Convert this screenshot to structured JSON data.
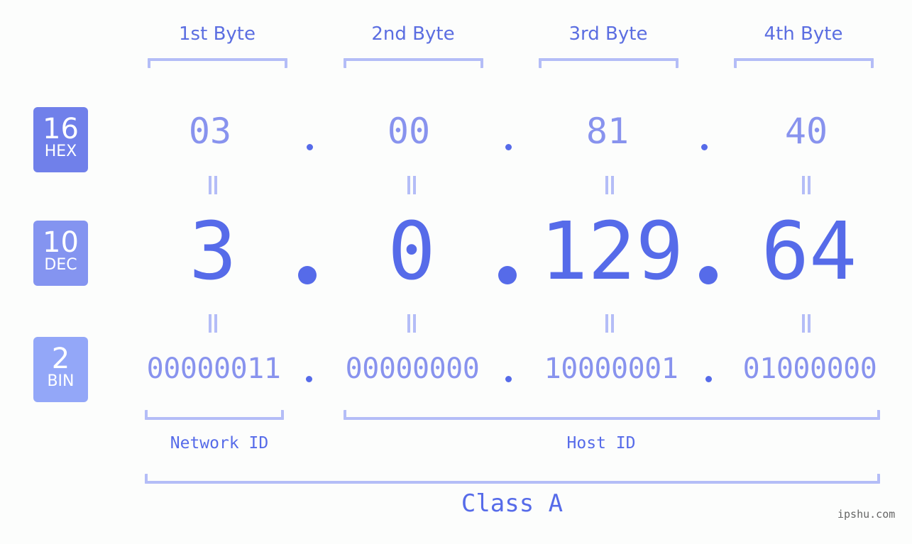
{
  "byte_headers": [
    "1st Byte",
    "2nd Byte",
    "3rd Byte",
    "4th Byte"
  ],
  "badges": {
    "hex": {
      "number": "16",
      "label": "HEX",
      "color": "#7080ea"
    },
    "dec": {
      "number": "10",
      "label": "DEC",
      "color": "#8494f0"
    },
    "bin": {
      "number": "2",
      "label": "BIN",
      "color": "#93a7f8"
    }
  },
  "hex_values": [
    "03",
    "00",
    "81",
    "40"
  ],
  "dec_values": [
    "3",
    "0",
    "129",
    "64"
  ],
  "bin_values": [
    "00000011",
    "00000000",
    "10000001",
    "01000000"
  ],
  "separator": ".",
  "equals_symbol": "=",
  "network_id_label": "Network ID",
  "host_id_label": "Host ID",
  "class_label": "Class A",
  "watermark": "ipshu.com",
  "colors": {
    "accent": "#566be9",
    "light_accent": "#8893ee",
    "bracket": "#b4bdf7",
    "background": "#fcfdfc"
  }
}
